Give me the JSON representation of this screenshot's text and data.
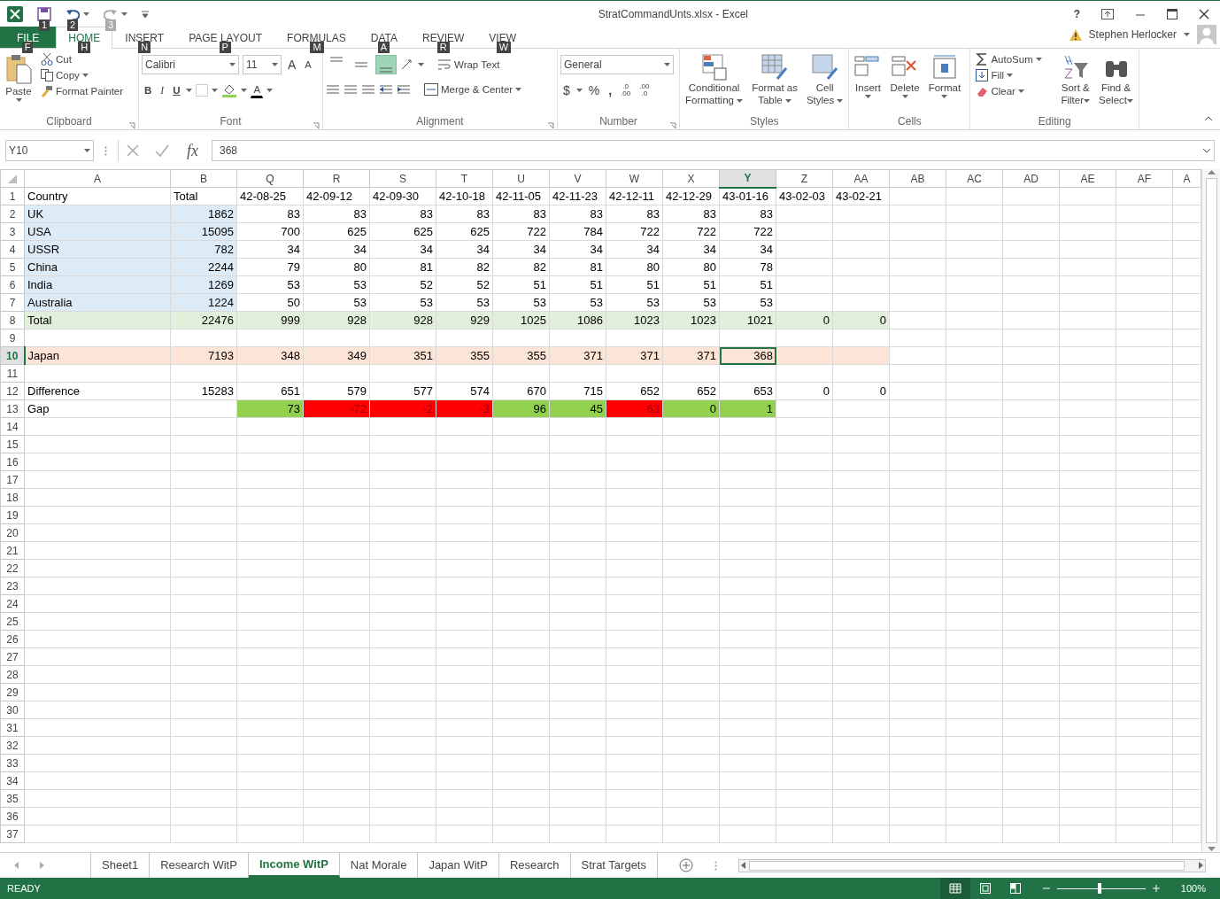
{
  "window": {
    "title": "StratCommandUnts.xlsx - Excel",
    "help": "?",
    "user": "Stephen Herlocker"
  },
  "quick_access": [
    {
      "keytip": "1",
      "disabled": false
    },
    {
      "keytip": "2",
      "disabled": false
    },
    {
      "keytip": "3",
      "disabled": true
    }
  ],
  "ribbon_tabs": [
    {
      "label": "FILE",
      "keytip": "F",
      "kind": "file",
      "selected": false
    },
    {
      "label": "HOME",
      "keytip": "H",
      "kind": "tab",
      "selected": true
    },
    {
      "label": "INSERT",
      "keytip": "N",
      "kind": "tab",
      "selected": false
    },
    {
      "label": "PAGE LAYOUT",
      "keytip": "P",
      "kind": "tab",
      "selected": false
    },
    {
      "label": "FORMULAS",
      "keytip": "M",
      "kind": "tab",
      "selected": false
    },
    {
      "label": "DATA",
      "keytip": "A",
      "kind": "tab",
      "selected": false
    },
    {
      "label": "REVIEW",
      "keytip": "R",
      "kind": "tab",
      "selected": false
    },
    {
      "label": "VIEW",
      "keytip": "W",
      "kind": "tab",
      "selected": false
    }
  ],
  "ribbon_groups": [
    {
      "kind": "clipboard",
      "label": "Clipboard",
      "paste": "Paste",
      "cut": "Cut",
      "copy": "Copy",
      "format_painter": "Format Painter"
    },
    {
      "kind": "font",
      "label": "Font",
      "font_name": "Calibri",
      "font_size": "11",
      "grow": "A",
      "shrink": "A",
      "bold": "B",
      "italic": "I",
      "underline": "U",
      "font_color": "A"
    },
    {
      "kind": "alignment",
      "label": "Alignment",
      "vertical_align": [
        {
          "selected": false
        },
        {
          "selected": false
        },
        {
          "selected": true
        }
      ],
      "wrap_text": "Wrap Text",
      "merge_center": "Merge & Center"
    },
    {
      "kind": "number",
      "label": "Number",
      "format": "General",
      "currency": "$",
      "percent": "%",
      "comma": ",",
      "add_decimal": [
        ".0",
        ".00"
      ],
      "remove_decimal": [
        ".00",
        ".0"
      ]
    },
    {
      "kind": "styles",
      "label": "Styles",
      "buttons": [
        {
          "lines": [
            "Conditional",
            "Formatting"
          ]
        },
        {
          "lines": [
            "Format as",
            "Table"
          ]
        },
        {
          "lines": [
            "Cell",
            "Styles"
          ]
        }
      ]
    },
    {
      "kind": "cells",
      "label": "Cells",
      "buttons": [
        {
          "lines": [
            "Insert"
          ]
        },
        {
          "lines": [
            "Delete"
          ]
        },
        {
          "lines": [
            "Format"
          ]
        }
      ]
    },
    {
      "kind": "editing",
      "label": "Editing",
      "autosum": "AutoSum",
      "fill": "Fill",
      "clear": "Clear",
      "buttons": [
        {
          "lines": [
            "Sort &",
            "Filter"
          ]
        },
        {
          "lines": [
            "Find &",
            "Select"
          ]
        }
      ]
    }
  ],
  "formula_bar": {
    "name_box": "Y10",
    "function_label": "fx",
    "value": "368"
  },
  "columns": [
    {
      "label": "A",
      "selected": false
    },
    {
      "label": "B",
      "selected": false
    },
    {
      "label": "Q",
      "selected": false
    },
    {
      "label": "R",
      "selected": false
    },
    {
      "label": "S",
      "selected": false
    },
    {
      "label": "T",
      "selected": false
    },
    {
      "label": "U",
      "selected": false
    },
    {
      "label": "V",
      "selected": false
    },
    {
      "label": "W",
      "selected": false
    },
    {
      "label": "X",
      "selected": false
    },
    {
      "label": "Y",
      "selected": true
    },
    {
      "label": "Z",
      "selected": false
    },
    {
      "label": "AA",
      "selected": false
    },
    {
      "label": "AB",
      "selected": false
    },
    {
      "label": "AC",
      "selected": false
    },
    {
      "label": "AD",
      "selected": false
    },
    {
      "label": "AE",
      "selected": false
    },
    {
      "label": "AF",
      "selected": false
    },
    {
      "label": "A",
      "selected": false
    }
  ],
  "rows": [
    {
      "number": "1",
      "selected": false,
      "kind": "header",
      "cells": [
        "Country",
        "Total",
        "42-08-25",
        "42-09-12",
        "42-09-30",
        "42-10-18",
        "42-11-05",
        "42-11-23",
        "42-12-11",
        "42-12-29",
        "43-01-16",
        "43-02-03",
        "43-02-21"
      ]
    },
    {
      "number": "2",
      "selected": false,
      "kind": "country",
      "cells": [
        "UK",
        "1862",
        "83",
        "83",
        "83",
        "83",
        "83",
        "83",
        "83",
        "83",
        "83"
      ]
    },
    {
      "number": "3",
      "selected": false,
      "kind": "country",
      "cells": [
        "USA",
        "15095",
        "700",
        "625",
        "625",
        "625",
        "722",
        "784",
        "722",
        "722",
        "722"
      ]
    },
    {
      "number": "4",
      "selected": false,
      "kind": "country",
      "cells": [
        "USSR",
        "782",
        "34",
        "34",
        "34",
        "34",
        "34",
        "34",
        "34",
        "34",
        "34"
      ]
    },
    {
      "number": "5",
      "selected": false,
      "kind": "country",
      "cells": [
        "China",
        "2244",
        "79",
        "80",
        "81",
        "82",
        "82",
        "81",
        "80",
        "80",
        "78"
      ]
    },
    {
      "number": "6",
      "selected": false,
      "kind": "country",
      "cells": [
        "India",
        "1269",
        "53",
        "53",
        "52",
        "52",
        "51",
        "51",
        "51",
        "51",
        "51"
      ]
    },
    {
      "number": "7",
      "selected": false,
      "kind": "country",
      "cells": [
        "Australia",
        "1224",
        "50",
        "53",
        "53",
        "53",
        "53",
        "53",
        "53",
        "53",
        "53"
      ]
    },
    {
      "number": "8",
      "selected": false,
      "kind": "total",
      "cells": [
        "Total",
        "22476",
        "999",
        "928",
        "928",
        "929",
        "1025",
        "1086",
        "1023",
        "1023",
        "1021",
        "0",
        "0"
      ]
    },
    {
      "number": "9",
      "selected": false
    },
    {
      "number": "10",
      "selected": true,
      "kind": "highlight",
      "cells": [
        "Japan",
        "7193",
        "348",
        "349",
        "351",
        "355",
        "355",
        "371",
        "371",
        "371",
        "368"
      ]
    },
    {
      "number": "11",
      "selected": false
    },
    {
      "number": "12",
      "selected": false,
      "kind": "plain",
      "cells": [
        "Difference",
        "15283",
        "651",
        "579",
        "577",
        "574",
        "670",
        "715",
        "652",
        "652",
        "653",
        "0",
        "0"
      ]
    },
    {
      "number": "13",
      "selected": false,
      "kind": "gap",
      "cells": [
        "Gap"
      ],
      "gaps": [
        {
          "text": "73",
          "positive": true
        },
        {
          "text": "-72",
          "positive": false
        },
        {
          "text": "-2",
          "positive": false
        },
        {
          "text": "-3",
          "positive": false
        },
        {
          "text": "96",
          "positive": true
        },
        {
          "text": "45",
          "positive": true
        },
        {
          "text": "-63",
          "positive": false
        },
        {
          "text": "0",
          "positive": true
        },
        {
          "text": "1",
          "positive": true
        }
      ]
    },
    {
      "number": "14",
      "selected": false
    },
    {
      "number": "15",
      "selected": false
    },
    {
      "number": "16",
      "selected": false
    },
    {
      "number": "17",
      "selected": false
    },
    {
      "number": "18",
      "selected": false
    },
    {
      "number": "19",
      "selected": false
    },
    {
      "number": "20",
      "selected": false
    },
    {
      "number": "21",
      "selected": false
    },
    {
      "number": "22",
      "selected": false
    },
    {
      "number": "23",
      "selected": false
    },
    {
      "number": "24",
      "selected": false
    },
    {
      "number": "25",
      "selected": false
    },
    {
      "number": "26",
      "selected": false
    },
    {
      "number": "27",
      "selected": false
    },
    {
      "number": "28",
      "selected": false
    },
    {
      "number": "29",
      "selected": false
    },
    {
      "number": "30",
      "selected": false
    },
    {
      "number": "31",
      "selected": false
    },
    {
      "number": "32",
      "selected": false
    },
    {
      "number": "33",
      "selected": false
    },
    {
      "number": "34",
      "selected": false
    },
    {
      "number": "35",
      "selected": false
    },
    {
      "number": "36",
      "selected": false
    },
    {
      "number": "37",
      "selected": false
    }
  ],
  "sheet_tabs": [
    {
      "label": "Sheet1",
      "selected": false
    },
    {
      "label": "Research WitP",
      "selected": false
    },
    {
      "label": "Income WitP",
      "selected": true
    },
    {
      "label": "Nat Morale",
      "selected": false
    },
    {
      "label": "Japan WitP",
      "selected": false
    },
    {
      "label": "Research",
      "selected": false
    },
    {
      "label": "Strat Targets",
      "selected": false
    }
  ],
  "status_bar": {
    "mode": "READY",
    "views": [
      {
        "selected": true
      },
      {
        "selected": false
      },
      {
        "selected": false
      }
    ],
    "zoom": {
      "level": 0.48
    },
    "zoom_label": "100%"
  }
}
